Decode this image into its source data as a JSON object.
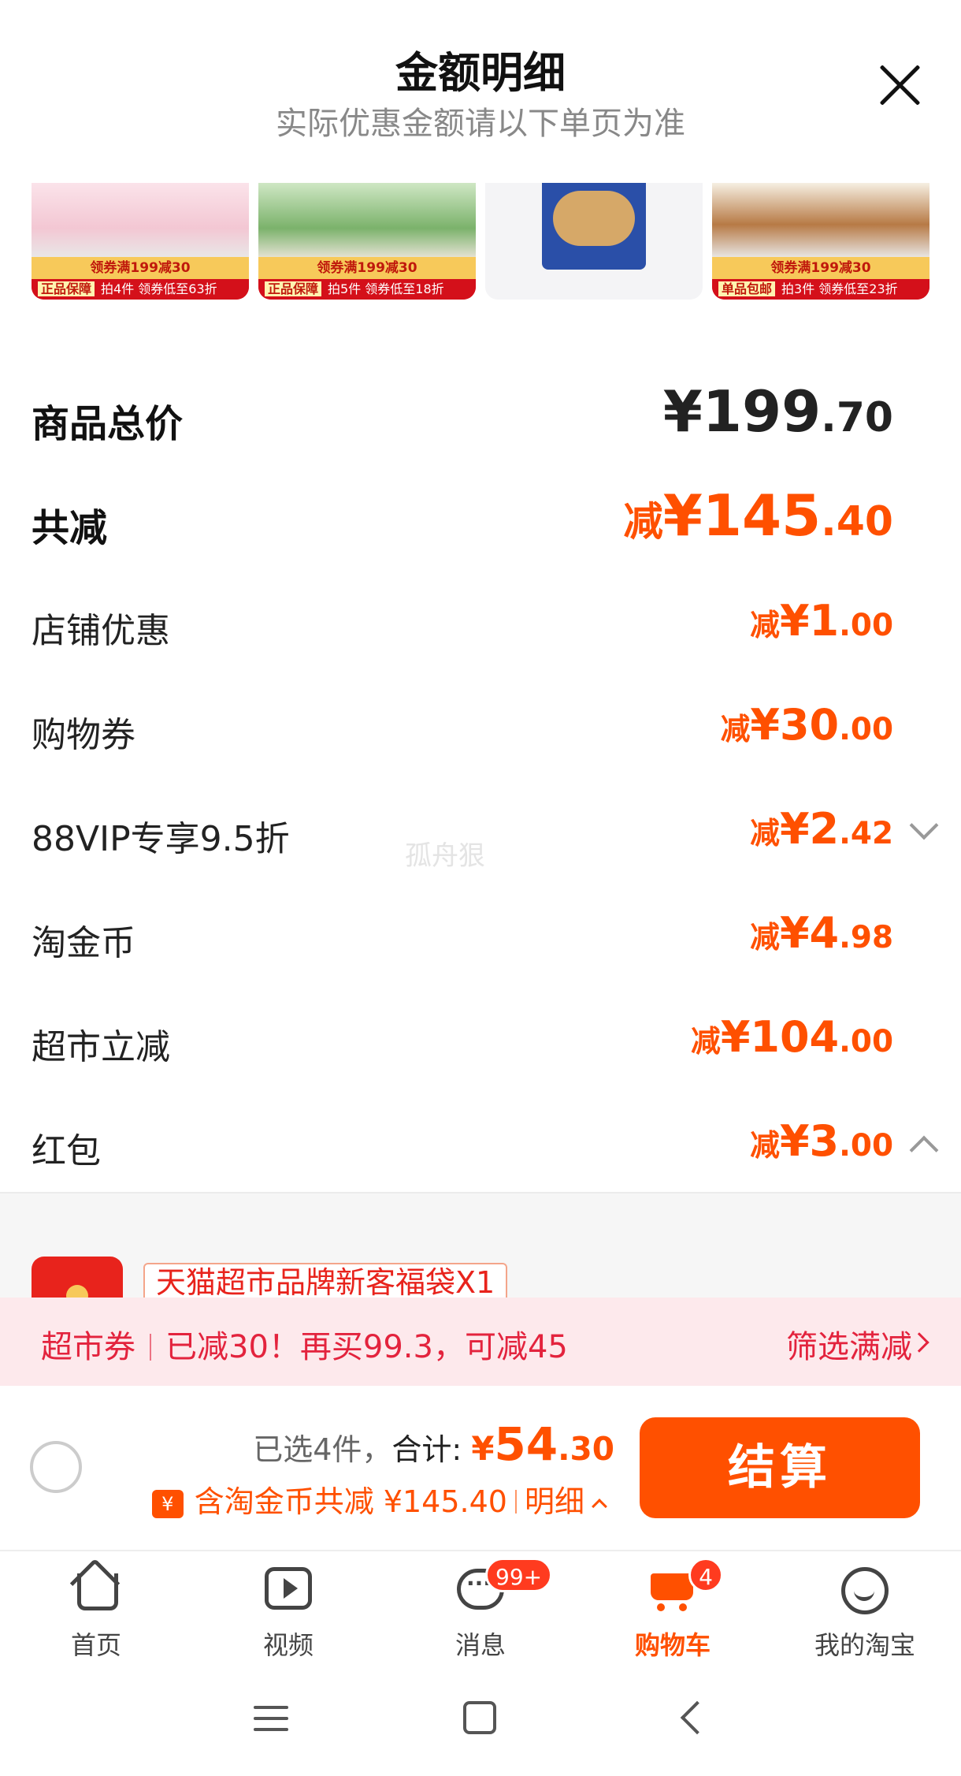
{
  "header": {
    "title": "金额明细",
    "subtitle": "实际优惠金额请以下单页为准"
  },
  "products": [
    {
      "band": "领券满199减30",
      "tag": "正品保障",
      "promo": "拍4件 领券低至63折"
    },
    {
      "band": "领券满199减30",
      "tag": "正品保障",
      "promo": "拍5件 领券低至18折"
    },
    {
      "band": "",
      "tag": "",
      "promo": ""
    },
    {
      "band": "领券满199减30",
      "tag": "单品包邮",
      "promo": "拍3件 领券低至23折"
    }
  ],
  "price_rows": [
    {
      "label": "商品总价",
      "prefix": "",
      "int": "¥199",
      "dec": ".70"
    },
    {
      "label": "共减",
      "prefix": "减",
      "int": "¥145",
      "dec": ".40"
    },
    {
      "label": "店铺优惠",
      "prefix": "减",
      "int": "¥1",
      "dec": ".00"
    },
    {
      "label": "购物券",
      "prefix": "减",
      "int": "¥30",
      "dec": ".00"
    },
    {
      "label": "88VIP专享9.5折",
      "prefix": "减",
      "int": "¥2",
      "dec": ".42"
    },
    {
      "label": "淘金币",
      "prefix": "减",
      "int": "¥4",
      "dec": ".98"
    },
    {
      "label": "超市立减",
      "prefix": "减",
      "int": "¥104",
      "dec": ".00"
    },
    {
      "label": "红包",
      "prefix": "减",
      "int": "¥3",
      "dec": ".00"
    }
  ],
  "redpacket": {
    "tag": "天猫超市品牌新客福袋X1"
  },
  "coupon_bar": {
    "label": "超市券",
    "message": "已减30！再买99.3，可减45",
    "filter": "筛选满减"
  },
  "checkout": {
    "selected": "已选4件，",
    "total_label": "合计:",
    "total_currency": "¥",
    "total_int": "54",
    "total_dec": ".30",
    "coin_icon": "¥",
    "discount_text": "含淘金币共减 ¥145.40",
    "detail_link": "明细",
    "button": "结算"
  },
  "tabs": [
    {
      "label": "首页",
      "icon": "home-icon"
    },
    {
      "label": "视频",
      "icon": "video-icon"
    },
    {
      "label": "消息",
      "icon": "message-icon",
      "badge": "99+"
    },
    {
      "label": "购物车",
      "icon": "cart-icon",
      "badge": "4",
      "active": true
    },
    {
      "label": "我的淘宝",
      "icon": "profile-icon"
    }
  ],
  "watermark": "孤舟狠",
  "colors": {
    "accent": "#ff5000",
    "coupon_text": "#e3233d",
    "coupon_bg": "#fde9ec"
  }
}
